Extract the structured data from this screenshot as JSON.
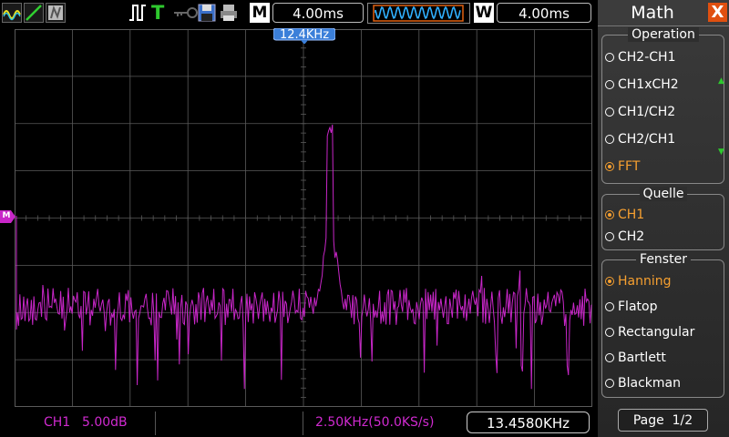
{
  "toolbar": {
    "timebase": "4.00ms",
    "window_time": "4.00ms",
    "m_label": "M",
    "w_label": "W",
    "trigger_mode_letter": "T",
    "trigger_color": "#2ec82e"
  },
  "marker": {
    "label": "12.4KHz"
  },
  "channel_marker": {
    "label": "M"
  },
  "status": {
    "channel": "CH1",
    "scale": "5.00dB",
    "sample": "2.50KHz(50.0KS/s)",
    "frequency": "13.4580KHz"
  },
  "menu": {
    "title": "Math",
    "close_label": "X",
    "groups": [
      {
        "title": "Operation",
        "options": [
          {
            "label": "CH2-CH1",
            "selected": false
          },
          {
            "label": "CH1xCH2",
            "selected": false
          },
          {
            "label": "CH1/CH2",
            "selected": false
          },
          {
            "label": "CH2/CH1",
            "selected": false
          },
          {
            "label": "FFT",
            "selected": true
          }
        ]
      },
      {
        "title": "Quelle",
        "options": [
          {
            "label": "CH1",
            "selected": true
          },
          {
            "label": "CH2",
            "selected": false
          }
        ]
      },
      {
        "title": "Fenster",
        "options": [
          {
            "label": "Hanning",
            "selected": true
          },
          {
            "label": "Flatop",
            "selected": false
          },
          {
            "label": "Rectangular",
            "selected": false
          },
          {
            "label": "Bartlett",
            "selected": false
          },
          {
            "label": "Blackman",
            "selected": false
          }
        ]
      }
    ],
    "page_label": "Page",
    "page_number": "1/2"
  },
  "colors": {
    "trace": "#c826c8",
    "grid": "#5a5a5a",
    "selected": "#f7a030",
    "marker": "#3b7fd9",
    "accent": "#e05010"
  },
  "icons": [
    "waveform-icon",
    "cursor-line-icon",
    "persist-icon",
    "pulse-trigger-icon",
    "key-icon",
    "save-disk-icon",
    "printer-icon"
  ]
}
